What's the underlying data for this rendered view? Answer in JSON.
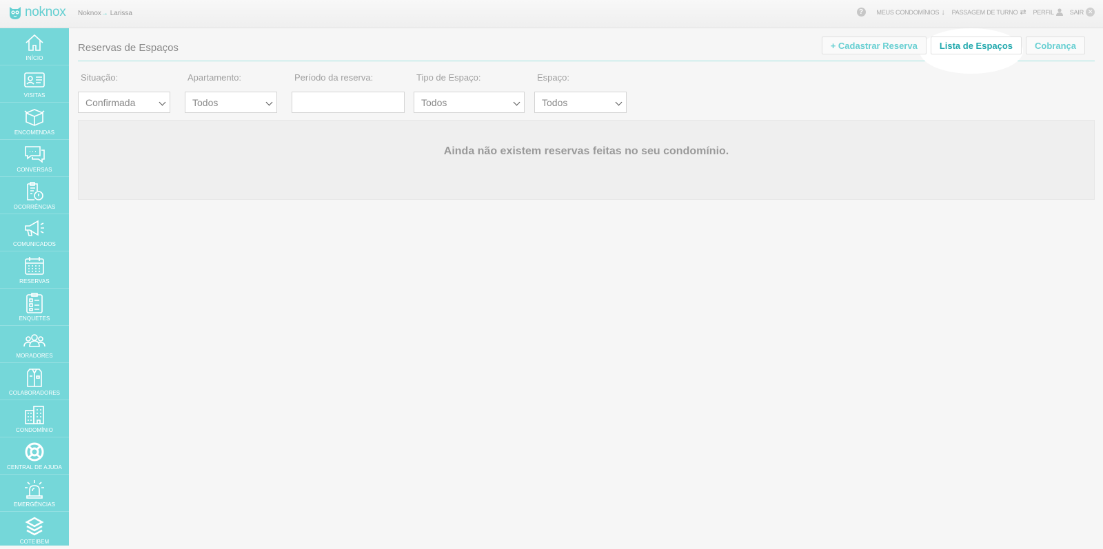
{
  "app": {
    "brand": "noknox",
    "accent": "#75d7d9"
  },
  "breadcrumb": {
    "org": "Noknox",
    "arrow": "→",
    "user": "Larissa"
  },
  "toplinks": [
    {
      "label": "MEUS CONDOMÍNIOS",
      "icon": "arrow-down-icon",
      "glyph": "↓"
    },
    {
      "label": "PASSAGEM DE TURNO",
      "icon": "swap-icon",
      "glyph": "⇄"
    },
    {
      "label": "PERFIL",
      "icon": "user-icon",
      "glyph": "👤"
    },
    {
      "label": "SAIR",
      "icon": "close-circle-icon",
      "glyph": "✕"
    }
  ],
  "help_glyph": "?",
  "sidebar": {
    "items": [
      {
        "label": "INÍCIO",
        "icon": "home-icon"
      },
      {
        "label": "VISITAS",
        "icon": "id-card-icon"
      },
      {
        "label": "ENCOMENDAS",
        "icon": "package-icon"
      },
      {
        "label": "CONVERSAS",
        "icon": "chat-icon"
      },
      {
        "label": "OCORRÊNCIAS",
        "icon": "clipboard-alert-icon"
      },
      {
        "label": "COMUNICADOS",
        "icon": "megaphone-icon"
      },
      {
        "label": "RESERVAS",
        "icon": "calendar-icon"
      },
      {
        "label": "ENQUETES",
        "icon": "checklist-icon"
      },
      {
        "label": "MORADORES",
        "icon": "people-icon"
      },
      {
        "label": "COLABORADORES",
        "icon": "uniform-icon"
      },
      {
        "label": "CONDOMÍNIO",
        "icon": "building-icon"
      },
      {
        "label": "CENTRAL DE AJUDA",
        "icon": "lifebuoy-icon"
      },
      {
        "label": "EMERGÊNCIAS",
        "icon": "siren-icon"
      },
      {
        "label": "COTEIBEM",
        "icon": "coteibem-icon"
      }
    ]
  },
  "page": {
    "title": "Reservas de Espaços",
    "tabs": [
      {
        "label": "+ Cadastrar Reserva",
        "active": false
      },
      {
        "label": "Lista de Espaços",
        "active": true
      },
      {
        "label": "Cobrança",
        "active": false
      }
    ]
  },
  "filters": {
    "situacao": {
      "label": "Situação:",
      "value": "Confirmada"
    },
    "apartamento": {
      "label": "Apartamento:",
      "value": "Todos"
    },
    "periodo": {
      "label": "Período da reserva:",
      "value": ""
    },
    "tipo": {
      "label": "Tipo de Espaço:",
      "value": "Todos"
    },
    "espaco": {
      "label": "Espaço:",
      "value": "Todos"
    }
  },
  "empty_message": "Ainda não existem reservas feitas no seu condomínio."
}
